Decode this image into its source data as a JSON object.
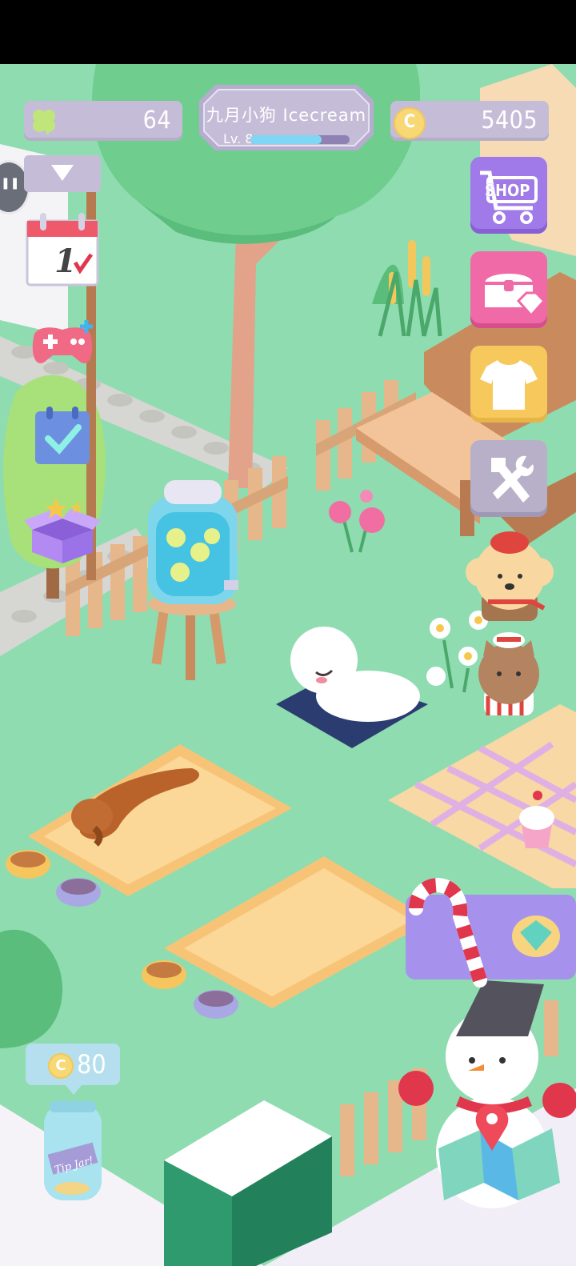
{
  "hud": {
    "clover_count": "64",
    "coin_count": "5405",
    "player_name": "九月小狗 Icecream",
    "level_label": "Lv. 8",
    "xp_progress": 0.72
  },
  "side_menu": {
    "shop_label": "SHOP",
    "calendar_day": "1"
  },
  "tip_jar": {
    "price": "80",
    "jar_label": "Tip Jar!"
  },
  "icons": {
    "clover": "clover-icon",
    "coin": "coin-icon",
    "collapse": "triangle-down-icon",
    "calendar": "calendar-icon",
    "gamepad": "gamepad-icon",
    "checklist": "checklist-icon",
    "gift_box": "gift-box-icon",
    "shop": "shopping-cart-icon",
    "chest": "treasure-chest-icon",
    "shirt": "t-shirt-icon",
    "tools": "hammer-wrench-icon",
    "map": "map-pin-icon"
  },
  "colors": {
    "grass": "#8fdcb0",
    "hud_panel": "#c5bdd7",
    "shop_purple": "#a07ae8",
    "chest_pink": "#f06aa8",
    "shirt_yellow": "#f7c85c",
    "tools_grey": "#b8b0c8"
  }
}
